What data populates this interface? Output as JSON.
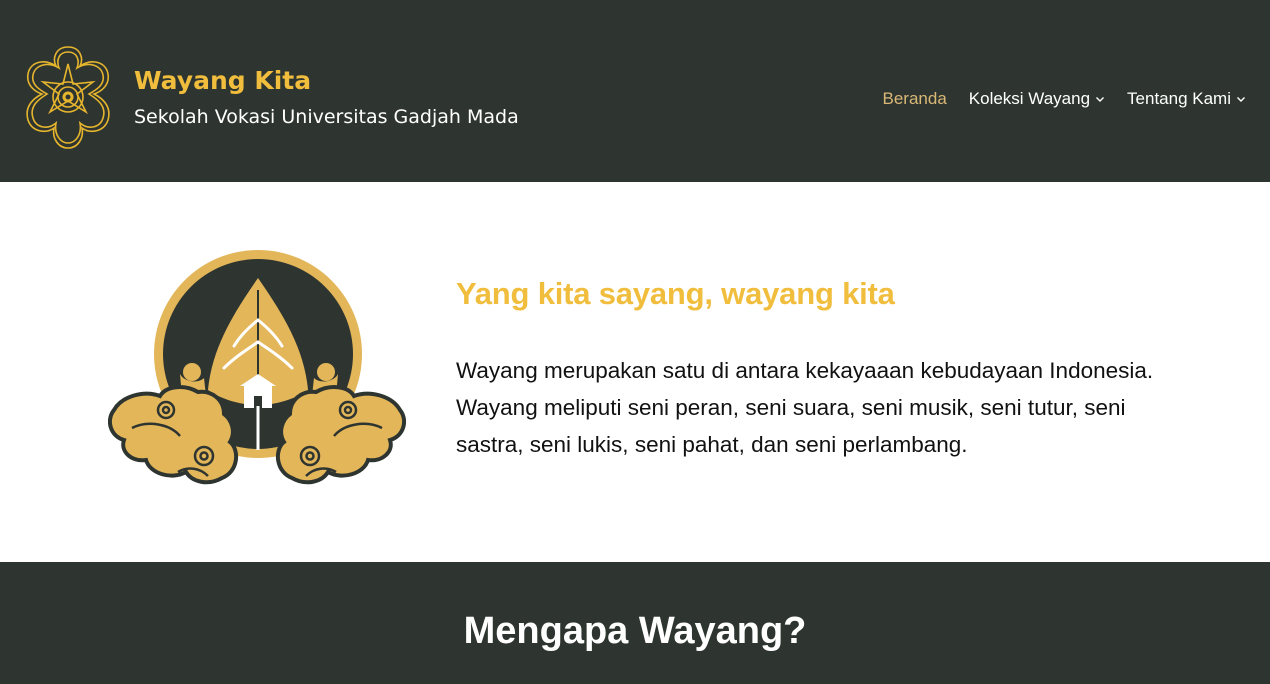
{
  "header": {
    "title": "Wayang Kita",
    "tagline": "Sekolah Vokasi Universitas Gadjah Mada",
    "logo_icon": "ugm-emblem-icon"
  },
  "nav": {
    "items": [
      {
        "label": "Beranda",
        "active": true,
        "has_dropdown": false
      },
      {
        "label": "Koleksi Wayang",
        "active": false,
        "has_dropdown": true
      },
      {
        "label": "Tentang Kami",
        "active": false,
        "has_dropdown": true
      }
    ]
  },
  "hero": {
    "logo_icon": "wayang-gunungan-logo-icon",
    "heading": "Yang kita sayang, wayang kita",
    "text": "Wayang merupakan satu di antara kekayaaan kebudayaan Indonesia. Wayang meliputi seni peran, seni suara, seni musik, seni tutur, seni sastra, seni lukis, seni pahat, dan seni perlambang."
  },
  "section": {
    "title": "Mengapa Wayang?"
  },
  "colors": {
    "header_bg": "#2e3530",
    "accent_gold": "#f1bd3d",
    "nav_active": "#d9b776",
    "logo_gold": "#e3b65a"
  }
}
